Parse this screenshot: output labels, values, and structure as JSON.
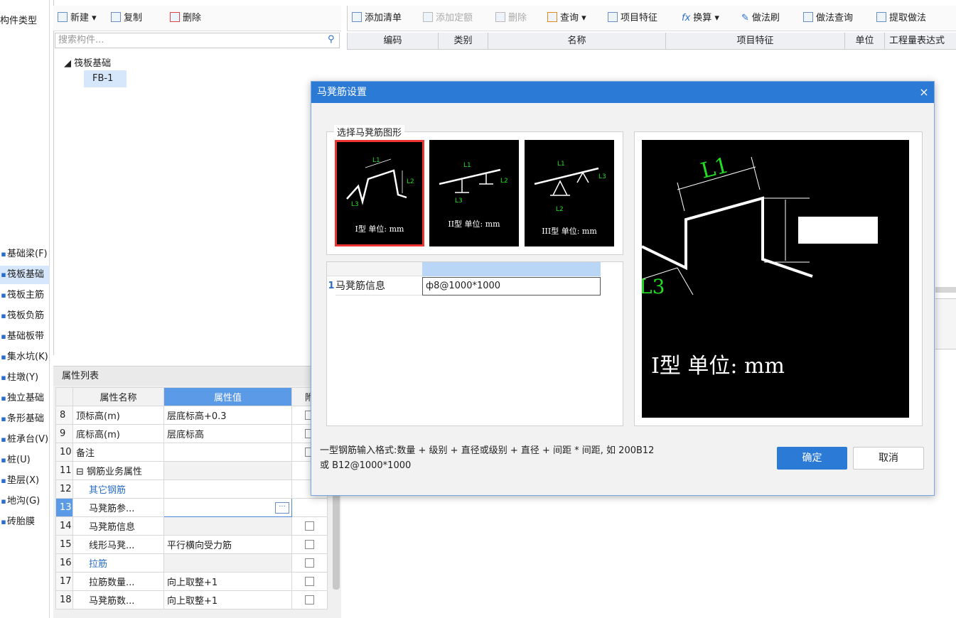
{
  "categories": {
    "title": "构件类型",
    "items": [
      {
        "label": "基础梁(F)",
        "selected": false
      },
      {
        "label": "筏板基础",
        "selected": true
      },
      {
        "label": "筏板主筋",
        "selected": false
      },
      {
        "label": "筏板负筋",
        "selected": false
      },
      {
        "label": "基础板带",
        "selected": false
      },
      {
        "label": "集水坑(K)",
        "selected": false
      },
      {
        "label": "柱墩(Y)",
        "selected": false
      },
      {
        "label": "独立基础",
        "selected": false
      },
      {
        "label": "条形基础",
        "selected": false
      },
      {
        "label": "桩承台(V)",
        "selected": false
      },
      {
        "label": "桩(U)",
        "selected": false
      },
      {
        "label": "垫层(X)",
        "selected": false
      },
      {
        "label": "地沟(G)",
        "selected": false
      },
      {
        "label": "砖胎膜",
        "selected": false
      }
    ]
  },
  "component_toolbar": {
    "new_label": "新建",
    "copy_label": "复制",
    "delete_label": "删除"
  },
  "component_search": {
    "placeholder": "搜索构件..."
  },
  "component_tree": {
    "root": "筏板基础",
    "child": "FB-1"
  },
  "attr_panel": {
    "title": "属性列表",
    "col_name": "属性名称",
    "col_value": "属性值",
    "col_extra": "附",
    "rows": [
      {
        "num": "8",
        "name": "顶标高(m)",
        "value": "层底标高+0.3",
        "check": true
      },
      {
        "num": "9",
        "name": "底标高(m)",
        "value": "层底标高",
        "check": true
      },
      {
        "num": "10",
        "name": "备注",
        "value": "",
        "check": true
      },
      {
        "num": "11",
        "name": "钢筋业务属性",
        "value": "",
        "check": false
      },
      {
        "num": "12",
        "name": "其它钢筋",
        "value": "",
        "check": false
      },
      {
        "num": "13",
        "name": "马凳筋参...",
        "value": "",
        "check": false
      },
      {
        "num": "14",
        "name": "马凳筋信息",
        "value": "",
        "check": true
      },
      {
        "num": "15",
        "name": "线形马凳...",
        "value": "平行横向受力筋",
        "check": true
      },
      {
        "num": "16",
        "name": "拉筋",
        "value": "",
        "check": true
      },
      {
        "num": "17",
        "name": "拉筋数量...",
        "value": "向上取整+1",
        "check": true
      },
      {
        "num": "18",
        "name": "马凳筋数...",
        "value": "向上取整+1",
        "check": true
      }
    ]
  },
  "list_toolbar": {
    "add_list": "添加清单",
    "add_quota": "添加定额",
    "delete": "删除",
    "query": "查询",
    "item_feature": "项目特征",
    "convert": "换算",
    "method_brush": "做法刷",
    "method_query": "做法查询",
    "extract_method": "提取做法"
  },
  "list_header": {
    "code": "编码",
    "category": "类别",
    "name": "名称",
    "feature": "项目特征",
    "unit": "单位",
    "expr": "工程量表达式"
  },
  "dialog": {
    "title": "马凳筋设置",
    "close": "×",
    "shape_legend": "选择马凳筋图形",
    "shapes": [
      {
        "caption": "I型 单位: mm",
        "selected": true
      },
      {
        "caption": "II型 单位: mm",
        "selected": false
      },
      {
        "caption": "III型 单位: mm",
        "selected": false
      }
    ],
    "grid": {
      "row_num": "1",
      "name": "马凳筋信息",
      "value": "ф8@1000*1000"
    },
    "preview_caption": "I型 单位: mm",
    "preview_labels": {
      "l1": "L1",
      "l3": "L3"
    },
    "hint_line1": "一型钢筋输入格式:数量 + 级别 + 直径或级别 + 直径 + 间距 * 间距, 如 200B12",
    "hint_line2": "或 B12@1000*1000",
    "ok_label": "确定",
    "cancel_label": "取消"
  },
  "colors": {
    "accent": "#2b7ad6",
    "selection": "#d6e7fb",
    "drawing_line": "#ffffff",
    "dimension_text": "#22dd22",
    "selected_border": "#e33333"
  }
}
